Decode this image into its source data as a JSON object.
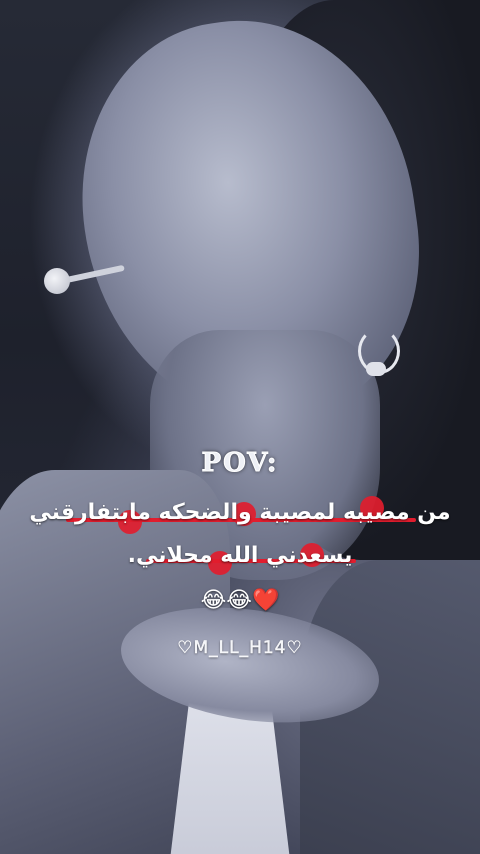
{
  "overlay": {
    "title": "POV:",
    "line1": "من مصيبه لمصيبة والضحكه مابتفارقني",
    "line2": "يسعدني الله محلاني.",
    "emojis": "😂😂❤️",
    "signature": "♡M_LL_H14♡"
  },
  "colors": {
    "accent": "#e11d2e",
    "text": "#ffffff"
  }
}
